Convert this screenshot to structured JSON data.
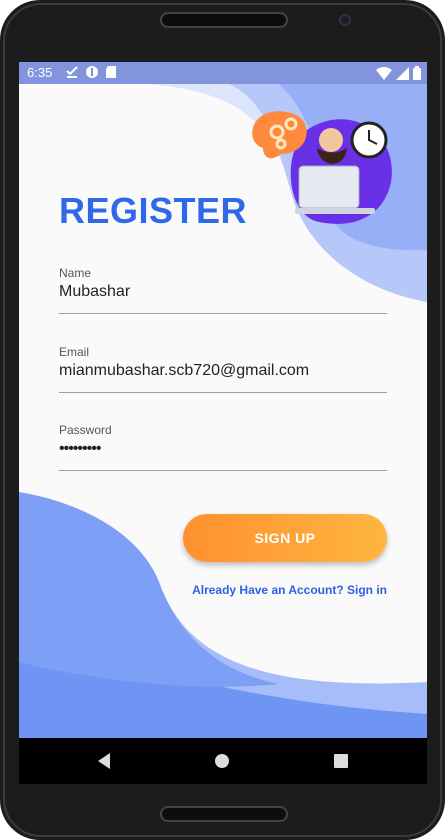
{
  "status_bar": {
    "time": "6:35",
    "left_icons": [
      "download-done-icon",
      "data-saver-icon",
      "sd-card-icon"
    ],
    "right_icons": [
      "wifi-icon",
      "signal-icon",
      "battery-icon"
    ]
  },
  "page": {
    "title": "REGISTER"
  },
  "form": {
    "name": {
      "label": "Name",
      "value": "Mubashar"
    },
    "email": {
      "label": "Email",
      "value": "mianmubashar.scb720@gmail.com"
    },
    "password": {
      "label": "Password",
      "value": "•••••••••"
    }
  },
  "actions": {
    "signup_label": "SIGN UP",
    "signin_link": "Already Have an Account? Sign in"
  },
  "nav": {
    "icons": [
      "back-icon",
      "home-icon",
      "recents-icon"
    ]
  },
  "colors": {
    "accent": "#2f68e8",
    "button_start": "#ff9030",
    "button_end": "#ffb640",
    "wave_light": "#c8d4fb",
    "wave_dark": "#6c93f3"
  }
}
